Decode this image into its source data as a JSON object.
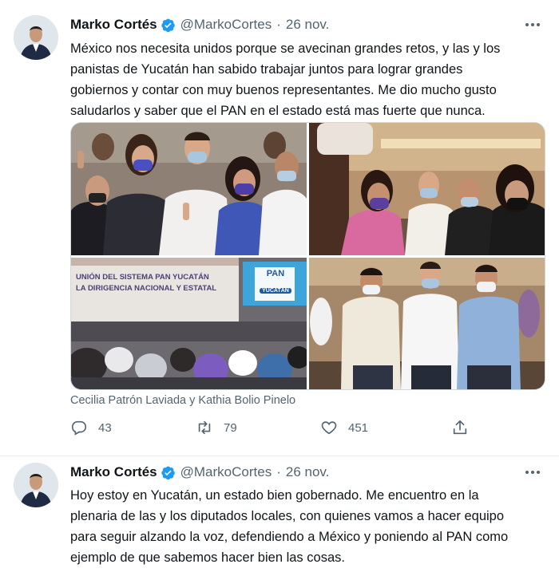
{
  "colors": {
    "verified": "#1d9bf0",
    "text": "#0f1419",
    "secondary": "#536471",
    "divider": "#e6ecf0"
  },
  "tweets": [
    {
      "author": {
        "name": "Marko Cortés",
        "handle": "@MarkoCortes",
        "verified_icon": "verified-badge-icon"
      },
      "separator": "·",
      "date": "26 nov.",
      "text": "México nos necesita unidos porque se avecinan grandes retos, y las y los\npanistas de Yucatán han sabido trabajar juntos para lograr grandes\ngobiernos y contar con muy buenos representantes. Me dio mucho gusto\nsaludarlos y saber que el PAN en el estado está mas fuerte que nunca.",
      "media": {
        "photos": [
          "group-v-sign-photo",
          "selfie-photo",
          "auditorium-photo",
          "three-men-photo"
        ],
        "banner_line1": "UNIÓN DEL SISTEMA PAN YUCATÁN",
        "banner_line2": "LA DIRIGENCIA NACIONAL Y ESTATAL",
        "logo_top": "PAN",
        "logo_bottom": "YUCATÁN"
      },
      "caption": "Cecilia Patrón Laviada y Kathia Bolio Pinelo",
      "replies": "43",
      "retweets": "79",
      "likes": "451"
    },
    {
      "author": {
        "name": "Marko Cortés",
        "handle": "@MarkoCortes",
        "verified_icon": "verified-badge-icon"
      },
      "separator": "·",
      "date": "26 nov.",
      "text": "Hoy estoy en Yucatán, un estado bien gobernado. Me encuentro en la\nplenaria de las y los diputados locales, con quienes vamos a hacer equipo\npara seguir alzando la voz, defendiendo a México y poniendo al PAN como\nejemplo de que sabemos hacer bien las cosas."
    }
  ]
}
